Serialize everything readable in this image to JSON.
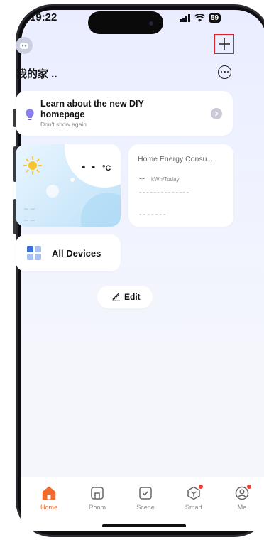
{
  "status_bar": {
    "time": "19:22",
    "battery": "59"
  },
  "header": {
    "home_name": "我的家 ..",
    "add_label": "+"
  },
  "banner": {
    "title": "Learn about the new DIY homepage",
    "subtitle": "Don't show again"
  },
  "weather": {
    "temperature": "- -",
    "unit": "°C",
    "placeholder_1": "– –",
    "placeholder_2": "– –"
  },
  "energy": {
    "title": "Home Energy Consu...",
    "value": "--",
    "unit": "kWh/Today",
    "placeholder": "-------"
  },
  "all_devices": {
    "label": "All Devices"
  },
  "edit": {
    "label": "Edit"
  },
  "tabs": [
    {
      "label": "Home",
      "icon": "home-icon",
      "active": true
    },
    {
      "label": "Room",
      "icon": "room-icon",
      "active": false
    },
    {
      "label": "Scene",
      "icon": "scene-icon",
      "active": false
    },
    {
      "label": "Smart",
      "icon": "smart-icon",
      "active": false
    },
    {
      "label": "Me",
      "icon": "me-icon",
      "active": false
    }
  ],
  "colors": {
    "accent": "#f26b2b",
    "badge": "#f3382f",
    "highlight_box": "#e0202a"
  }
}
